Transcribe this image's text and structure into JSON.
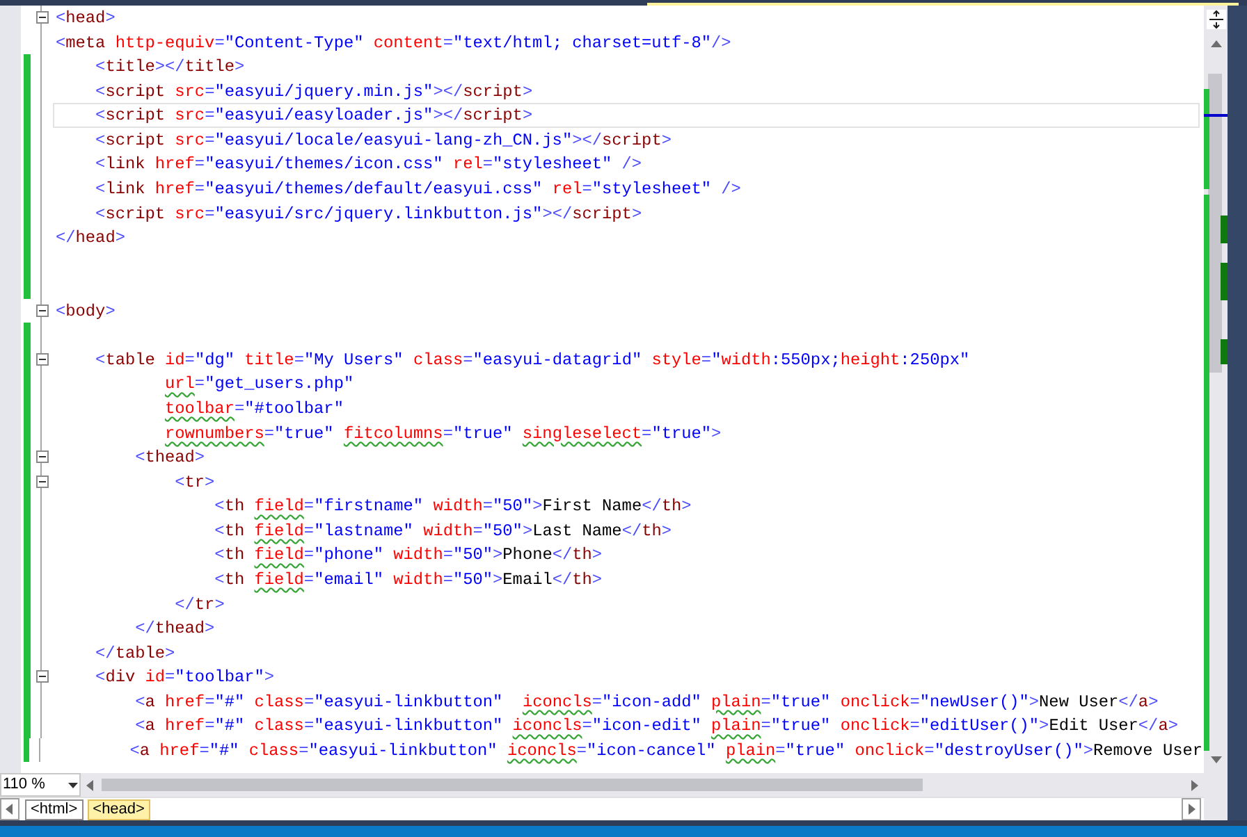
{
  "editor": {
    "lines": [
      {
        "changed": false,
        "fold": true,
        "current": false,
        "tokens": [
          {
            "kind": "punct",
            "text": "<"
          },
          {
            "kind": "tag",
            "text": "head"
          },
          {
            "kind": "punct",
            "text": ">"
          }
        ]
      },
      {
        "changed": false,
        "fold": false,
        "current": false,
        "tokens": [
          {
            "kind": "punct",
            "text": "<"
          },
          {
            "kind": "tag",
            "text": "meta "
          },
          {
            "kind": "attr",
            "text": "http-equiv"
          },
          {
            "kind": "punct",
            "text": "="
          },
          {
            "kind": "value",
            "text": "\"Content-Type\" "
          },
          {
            "kind": "attr",
            "text": "content"
          },
          {
            "kind": "punct",
            "text": "="
          },
          {
            "kind": "value",
            "text": "\"text/html; charset=utf-8\""
          },
          {
            "kind": "punct",
            "text": "/>"
          }
        ]
      },
      {
        "changed": true,
        "fold": false,
        "current": false,
        "tokens": [
          {
            "kind": "punct",
            "text": "    <"
          },
          {
            "kind": "tag",
            "text": "title"
          },
          {
            "kind": "punct",
            "text": "></"
          },
          {
            "kind": "tag",
            "text": "title"
          },
          {
            "kind": "punct",
            "text": ">"
          }
        ]
      },
      {
        "changed": true,
        "fold": false,
        "current": false,
        "tokens": [
          {
            "kind": "punct",
            "text": "    <"
          },
          {
            "kind": "tag",
            "text": "script "
          },
          {
            "kind": "attr",
            "text": "src"
          },
          {
            "kind": "punct",
            "text": "="
          },
          {
            "kind": "value",
            "text": "\"easyui/jquery.min.js\""
          },
          {
            "kind": "punct",
            "text": "></"
          },
          {
            "kind": "tag",
            "text": "script"
          },
          {
            "kind": "punct",
            "text": ">"
          }
        ]
      },
      {
        "changed": true,
        "fold": false,
        "current": true,
        "tokens": [
          {
            "kind": "punct",
            "text": "    <"
          },
          {
            "kind": "tag",
            "text": "script "
          },
          {
            "kind": "attr",
            "text": "src"
          },
          {
            "kind": "punct",
            "text": "="
          },
          {
            "kind": "value",
            "text": "\"easyui/easyloader.js\""
          },
          {
            "kind": "punct",
            "text": "></"
          },
          {
            "kind": "tag",
            "text": "script"
          },
          {
            "kind": "punct",
            "text": ">"
          }
        ]
      },
      {
        "changed": true,
        "fold": false,
        "current": false,
        "tokens": [
          {
            "kind": "punct",
            "text": "    <"
          },
          {
            "kind": "tag",
            "text": "script "
          },
          {
            "kind": "attr",
            "text": "src"
          },
          {
            "kind": "punct",
            "text": "="
          },
          {
            "kind": "value",
            "text": "\"easyui/locale/easyui-lang-zh_CN.js\""
          },
          {
            "kind": "punct",
            "text": "></"
          },
          {
            "kind": "tag",
            "text": "script"
          },
          {
            "kind": "punct",
            "text": ">"
          }
        ]
      },
      {
        "changed": true,
        "fold": false,
        "current": false,
        "tokens": [
          {
            "kind": "punct",
            "text": "    <"
          },
          {
            "kind": "tag",
            "text": "link "
          },
          {
            "kind": "attr",
            "text": "href"
          },
          {
            "kind": "punct",
            "text": "="
          },
          {
            "kind": "value",
            "text": "\"easyui/themes/icon.css\" "
          },
          {
            "kind": "attr",
            "text": "rel"
          },
          {
            "kind": "punct",
            "text": "="
          },
          {
            "kind": "value",
            "text": "\"stylesheet\" "
          },
          {
            "kind": "punct",
            "text": "/>"
          }
        ]
      },
      {
        "changed": true,
        "fold": false,
        "current": false,
        "tokens": [
          {
            "kind": "punct",
            "text": "    <"
          },
          {
            "kind": "tag",
            "text": "link "
          },
          {
            "kind": "attr",
            "text": "href"
          },
          {
            "kind": "punct",
            "text": "="
          },
          {
            "kind": "value",
            "text": "\"easyui/themes/default/easyui.css\" "
          },
          {
            "kind": "attr",
            "text": "rel"
          },
          {
            "kind": "punct",
            "text": "="
          },
          {
            "kind": "value",
            "text": "\"stylesheet\" "
          },
          {
            "kind": "punct",
            "text": "/>"
          }
        ]
      },
      {
        "changed": true,
        "fold": false,
        "current": false,
        "tokens": [
          {
            "kind": "punct",
            "text": "    <"
          },
          {
            "kind": "tag",
            "text": "script "
          },
          {
            "kind": "attr",
            "text": "src"
          },
          {
            "kind": "punct",
            "text": "="
          },
          {
            "kind": "value",
            "text": "\"easyui/src/jquery.linkbutton.js\""
          },
          {
            "kind": "punct",
            "text": "></"
          },
          {
            "kind": "tag",
            "text": "script"
          },
          {
            "kind": "punct",
            "text": ">"
          }
        ]
      },
      {
        "changed": true,
        "fold": false,
        "current": false,
        "tokens": [
          {
            "kind": "punct",
            "text": "</"
          },
          {
            "kind": "tag",
            "text": "head"
          },
          {
            "kind": "punct",
            "text": ">"
          }
        ]
      },
      {
        "changed": true,
        "fold": false,
        "current": false
      },
      {
        "changed": true,
        "fold": false,
        "current": false
      },
      {
        "changed": false,
        "fold": true,
        "current": false,
        "tokens": [
          {
            "kind": "punct",
            "text": "<"
          },
          {
            "kind": "tag",
            "text": "body"
          },
          {
            "kind": "punct",
            "text": ">"
          }
        ]
      },
      {
        "changed": true,
        "fold": false,
        "current": false
      },
      {
        "changed": true,
        "fold": true,
        "current": false,
        "tokens": [
          {
            "kind": "punct",
            "text": "    <"
          },
          {
            "kind": "tag",
            "text": "table "
          },
          {
            "kind": "attr",
            "text": "id"
          },
          {
            "kind": "punct",
            "text": "="
          },
          {
            "kind": "value",
            "text": "\"dg\" "
          },
          {
            "kind": "attr",
            "text": "title"
          },
          {
            "kind": "punct",
            "text": "="
          },
          {
            "kind": "value",
            "text": "\"My Users\" "
          },
          {
            "kind": "attr",
            "text": "class"
          },
          {
            "kind": "punct",
            "text": "="
          },
          {
            "kind": "value",
            "text": "\"easyui-datagrid\" "
          },
          {
            "kind": "attr",
            "text": "style"
          },
          {
            "kind": "punct",
            "text": "="
          },
          {
            "kind": "value",
            "text": "\""
          },
          {
            "kind": "attr",
            "text": "width"
          },
          {
            "kind": "value",
            "text": ":550px;"
          },
          {
            "kind": "attr",
            "text": "height"
          },
          {
            "kind": "value",
            "text": ":250px\""
          }
        ]
      },
      {
        "changed": true,
        "fold": false,
        "current": false,
        "tokens": [
          {
            "kind": "attr_warn",
            "text": "           url"
          },
          {
            "kind": "punct",
            "text": "="
          },
          {
            "kind": "value",
            "text": "\"get_users.php\""
          }
        ]
      },
      {
        "changed": true,
        "fold": false,
        "current": false,
        "tokens": [
          {
            "kind": "attr_warn",
            "text": "           toolbar"
          },
          {
            "kind": "punct",
            "text": "="
          },
          {
            "kind": "value",
            "text": "\"#toolbar\""
          }
        ]
      },
      {
        "changed": true,
        "fold": false,
        "current": false,
        "tokens": [
          {
            "kind": "attr_warn",
            "text": "           rownumbers"
          },
          {
            "kind": "punct",
            "text": "="
          },
          {
            "kind": "value",
            "text": "\"true\" "
          },
          {
            "kind": "attr_warn",
            "text": "fitcolumns"
          },
          {
            "kind": "punct",
            "text": "="
          },
          {
            "kind": "value",
            "text": "\"true\" "
          },
          {
            "kind": "attr_warn",
            "text": "singleselect"
          },
          {
            "kind": "punct",
            "text": "="
          },
          {
            "kind": "value",
            "text": "\"true\""
          },
          {
            "kind": "punct",
            "text": ">"
          }
        ]
      },
      {
        "changed": true,
        "fold": true,
        "current": false,
        "tokens": [
          {
            "kind": "punct",
            "text": "        <"
          },
          {
            "kind": "tag",
            "text": "thead"
          },
          {
            "kind": "punct",
            "text": ">"
          }
        ]
      },
      {
        "changed": true,
        "fold": true,
        "current": false,
        "tokens": [
          {
            "kind": "punct",
            "text": "            <"
          },
          {
            "kind": "tag",
            "text": "tr"
          },
          {
            "kind": "punct",
            "text": ">"
          }
        ]
      },
      {
        "changed": true,
        "fold": false,
        "current": false,
        "tokens": [
          {
            "kind": "punct",
            "text": "                <"
          },
          {
            "kind": "tag",
            "text": "th "
          },
          {
            "kind": "attr_warn",
            "text": "field"
          },
          {
            "kind": "punct",
            "text": "="
          },
          {
            "kind": "value",
            "text": "\"firstname\" "
          },
          {
            "kind": "attr",
            "text": "width"
          },
          {
            "kind": "punct",
            "text": "="
          },
          {
            "kind": "value",
            "text": "\"50\""
          },
          {
            "kind": "punct",
            "text": ">"
          },
          {
            "kind": "text",
            "text": "First Name"
          },
          {
            "kind": "punct",
            "text": "</"
          },
          {
            "kind": "tag",
            "text": "th"
          },
          {
            "kind": "punct",
            "text": ">"
          }
        ]
      },
      {
        "changed": true,
        "fold": false,
        "current": false,
        "tokens": [
          {
            "kind": "punct",
            "text": "                <"
          },
          {
            "kind": "tag",
            "text": "th "
          },
          {
            "kind": "attr_warn",
            "text": "field"
          },
          {
            "kind": "punct",
            "text": "="
          },
          {
            "kind": "value",
            "text": "\"lastname\" "
          },
          {
            "kind": "attr",
            "text": "width"
          },
          {
            "kind": "punct",
            "text": "="
          },
          {
            "kind": "value",
            "text": "\"50\""
          },
          {
            "kind": "punct",
            "text": ">"
          },
          {
            "kind": "text",
            "text": "Last Name"
          },
          {
            "kind": "punct",
            "text": "</"
          },
          {
            "kind": "tag",
            "text": "th"
          },
          {
            "kind": "punct",
            "text": ">"
          }
        ]
      },
      {
        "changed": true,
        "fold": false,
        "current": false,
        "tokens": [
          {
            "kind": "punct",
            "text": "                <"
          },
          {
            "kind": "tag",
            "text": "th "
          },
          {
            "kind": "attr_warn",
            "text": "field"
          },
          {
            "kind": "punct",
            "text": "="
          },
          {
            "kind": "value",
            "text": "\"phone\" "
          },
          {
            "kind": "attr",
            "text": "width"
          },
          {
            "kind": "punct",
            "text": "="
          },
          {
            "kind": "value",
            "text": "\"50\""
          },
          {
            "kind": "punct",
            "text": ">"
          },
          {
            "kind": "text",
            "text": "Phone"
          },
          {
            "kind": "punct",
            "text": "</"
          },
          {
            "kind": "tag",
            "text": "th"
          },
          {
            "kind": "punct",
            "text": ">"
          }
        ]
      },
      {
        "changed": true,
        "fold": false,
        "current": false,
        "tokens": [
          {
            "kind": "punct",
            "text": "                <"
          },
          {
            "kind": "tag",
            "text": "th "
          },
          {
            "kind": "attr_warn",
            "text": "field"
          },
          {
            "kind": "punct",
            "text": "="
          },
          {
            "kind": "value",
            "text": "\"email\" "
          },
          {
            "kind": "attr",
            "text": "width"
          },
          {
            "kind": "punct",
            "text": "="
          },
          {
            "kind": "value",
            "text": "\"50\""
          },
          {
            "kind": "punct",
            "text": ">"
          },
          {
            "kind": "text",
            "text": "Email"
          },
          {
            "kind": "punct",
            "text": "</"
          },
          {
            "kind": "tag",
            "text": "th"
          },
          {
            "kind": "punct",
            "text": ">"
          }
        ]
      },
      {
        "changed": true,
        "fold": false,
        "current": false,
        "tokens": [
          {
            "kind": "punct",
            "text": "            </"
          },
          {
            "kind": "tag",
            "text": "tr"
          },
          {
            "kind": "punct",
            "text": ">"
          }
        ]
      },
      {
        "changed": true,
        "fold": false,
        "current": false,
        "tokens": [
          {
            "kind": "punct",
            "text": "        </"
          },
          {
            "kind": "tag",
            "text": "thead"
          },
          {
            "kind": "punct",
            "text": ">"
          }
        ]
      },
      {
        "changed": true,
        "fold": false,
        "current": false,
        "tokens": [
          {
            "kind": "punct",
            "text": "    </"
          },
          {
            "kind": "tag",
            "text": "table"
          },
          {
            "kind": "punct",
            "text": ">"
          }
        ]
      },
      {
        "changed": true,
        "fold": true,
        "current": false,
        "tokens": [
          {
            "kind": "punct",
            "text": "    <"
          },
          {
            "kind": "tag",
            "text": "div "
          },
          {
            "kind": "attr",
            "text": "id"
          },
          {
            "kind": "punct",
            "text": "="
          },
          {
            "kind": "value",
            "text": "\"toolbar\""
          },
          {
            "kind": "punct",
            "text": ">"
          }
        ]
      },
      {
        "changed": true,
        "fold": false,
        "current": false,
        "tokens": [
          {
            "kind": "punct",
            "text": "        <"
          },
          {
            "kind": "tag",
            "text": "a "
          },
          {
            "kind": "attr",
            "text": "href"
          },
          {
            "kind": "punct",
            "text": "="
          },
          {
            "kind": "value",
            "text": "\"#\" "
          },
          {
            "kind": "attr",
            "text": "class"
          },
          {
            "kind": "punct",
            "text": "="
          },
          {
            "kind": "value",
            "text": "\"easyui-linkbutton\"  "
          },
          {
            "kind": "attr_warn",
            "text": "iconcls"
          },
          {
            "kind": "punct",
            "text": "="
          },
          {
            "kind": "value",
            "text": "\"icon-add\" "
          },
          {
            "kind": "attr_warn",
            "text": "plain"
          },
          {
            "kind": "punct",
            "text": "="
          },
          {
            "kind": "value",
            "text": "\"true\" "
          },
          {
            "kind": "attr",
            "text": "onclick"
          },
          {
            "kind": "punct",
            "text": "="
          },
          {
            "kind": "value",
            "text": "\"newUser()\""
          },
          {
            "kind": "punct",
            "text": ">"
          },
          {
            "kind": "text",
            "text": "New User"
          },
          {
            "kind": "punct",
            "text": "</"
          },
          {
            "kind": "tag",
            "text": "a"
          },
          {
            "kind": "punct",
            "text": ">"
          }
        ]
      },
      {
        "changed": true,
        "fold": false,
        "current": false,
        "tokens": [
          {
            "kind": "punct",
            "text": "        <"
          },
          {
            "kind": "tag",
            "text": "a "
          },
          {
            "kind": "attr",
            "text": "href"
          },
          {
            "kind": "punct",
            "text": "="
          },
          {
            "kind": "value",
            "text": "\"#\" "
          },
          {
            "kind": "attr",
            "text": "class"
          },
          {
            "kind": "punct",
            "text": "="
          },
          {
            "kind": "value",
            "text": "\"easyui-linkbutton\" "
          },
          {
            "kind": "attr_warn",
            "text": "iconcls"
          },
          {
            "kind": "punct",
            "text": "="
          },
          {
            "kind": "value",
            "text": "\"icon-edit\" "
          },
          {
            "kind": "attr_warn",
            "text": "plain"
          },
          {
            "kind": "punct",
            "text": "="
          },
          {
            "kind": "value",
            "text": "\"true\" "
          },
          {
            "kind": "attr",
            "text": "onclick"
          },
          {
            "kind": "punct",
            "text": "="
          },
          {
            "kind": "value",
            "text": "\"editUser()\""
          },
          {
            "kind": "punct",
            "text": ">"
          },
          {
            "kind": "text",
            "text": "Edit User"
          },
          {
            "kind": "punct",
            "text": "</"
          },
          {
            "kind": "tag",
            "text": "a"
          },
          {
            "kind": "punct",
            "text": ">"
          }
        ]
      },
      {
        "changed": true,
        "fold": false,
        "current": false,
        "tokens": [
          {
            "kind": "punct",
            "text": "        <"
          },
          {
            "kind": "tag",
            "text": "a "
          },
          {
            "kind": "attr",
            "text": "href"
          },
          {
            "kind": "punct",
            "text": "="
          },
          {
            "kind": "value",
            "text": "\"#\" "
          },
          {
            "kind": "attr",
            "text": "class"
          },
          {
            "kind": "punct",
            "text": "="
          },
          {
            "kind": "value",
            "text": "\"easyui-linkbutton\" "
          },
          {
            "kind": "attr_warn",
            "text": "iconcls"
          },
          {
            "kind": "punct",
            "text": "="
          },
          {
            "kind": "value",
            "text": "\"icon-cancel\" "
          },
          {
            "kind": "attr_warn",
            "text": "plain"
          },
          {
            "kind": "punct",
            "text": "="
          },
          {
            "kind": "value",
            "text": "\"true\" "
          },
          {
            "kind": "attr",
            "text": "onclick"
          },
          {
            "kind": "punct",
            "text": "="
          },
          {
            "kind": "value",
            "text": "\"destroyUser()\""
          },
          {
            "kind": "punct",
            "text": ">"
          },
          {
            "kind": "text",
            "text": "Remove User"
          }
        ]
      }
    ]
  },
  "zoom": {
    "value": "110 %"
  },
  "breadcrumbs": [
    {
      "label": "<html>",
      "selected": false
    },
    {
      "label": "<head>",
      "selected": true
    }
  ]
}
